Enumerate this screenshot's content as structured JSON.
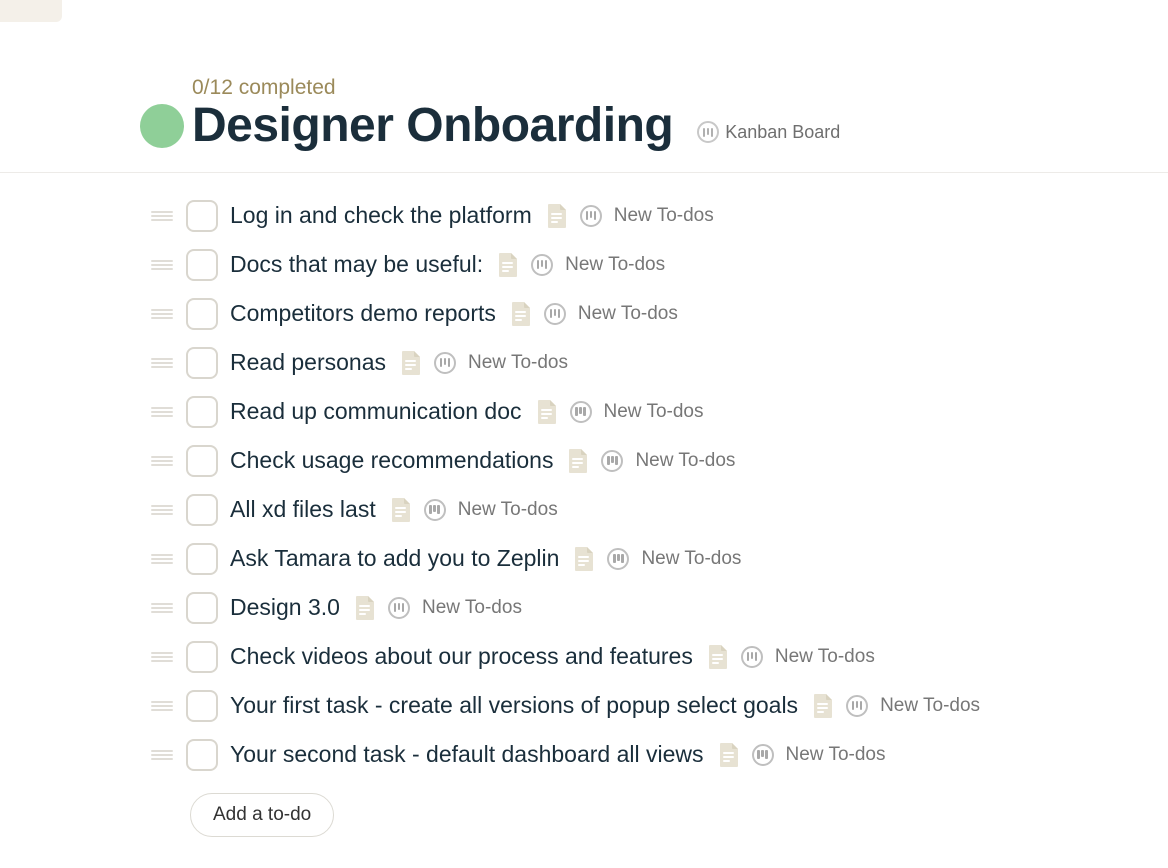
{
  "header": {
    "completion_text": "0/12 completed",
    "title": "Designer Onboarding",
    "board_label": "Kanban Board"
  },
  "task_status_label": "New To-dos",
  "tasks": [
    {
      "title": "Log in and check the platform"
    },
    {
      "title": "Docs that may be useful:"
    },
    {
      "title": "Competitors demo reports"
    },
    {
      "title": "Read personas"
    },
    {
      "title": "Read up communication doc"
    },
    {
      "title": "Check usage recommendations"
    },
    {
      "title": "All xd files last"
    },
    {
      "title": "Ask Tamara to add you to Zeplin"
    },
    {
      "title": "Design 3.0"
    },
    {
      "title": "Check videos about our process and features"
    },
    {
      "title": "Your first task - create all versions of popup select goals"
    },
    {
      "title": "Your second task - default dashboard all views"
    }
  ],
  "add_button_label": "Add a to-do"
}
